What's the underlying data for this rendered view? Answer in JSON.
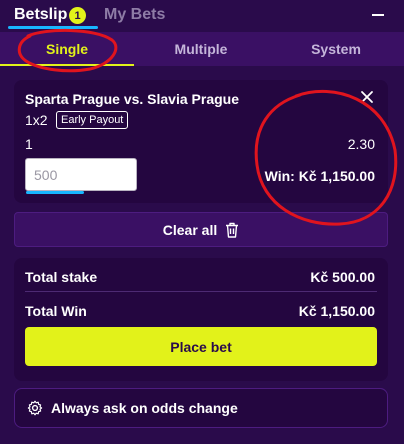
{
  "header": {
    "betslip_label": "Betslip",
    "badge_count": "1",
    "mybets_label": "My Bets"
  },
  "subtabs": {
    "single": "Single",
    "multiple": "Multiple",
    "system": "System"
  },
  "bet": {
    "match": "Sparta Prague vs. Slavia Prague",
    "market": "1x2",
    "early_payout": "Early Payout",
    "selection": "1",
    "odds": "2.30",
    "stake_placeholder": "500",
    "win_label": "Win:",
    "win_value": "Kč 1,150.00"
  },
  "actions": {
    "clear_all": "Clear all"
  },
  "totals": {
    "stake_label": "Total stake",
    "stake_value": "Kč 500.00",
    "win_label": "Total Win",
    "win_value": "Kč 1,150.00",
    "place_bet": "Place bet"
  },
  "settings": {
    "odds_change": "Always ask on odds change"
  },
  "colors": {
    "background": "#2a0b4b",
    "accent": "#e2f21a",
    "highlight": "#18b6ff",
    "annotation": "#e0141e"
  },
  "icons": {
    "close": "close-icon",
    "trash": "trash-icon",
    "gear": "gear-icon",
    "collapse": "minus-icon"
  }
}
